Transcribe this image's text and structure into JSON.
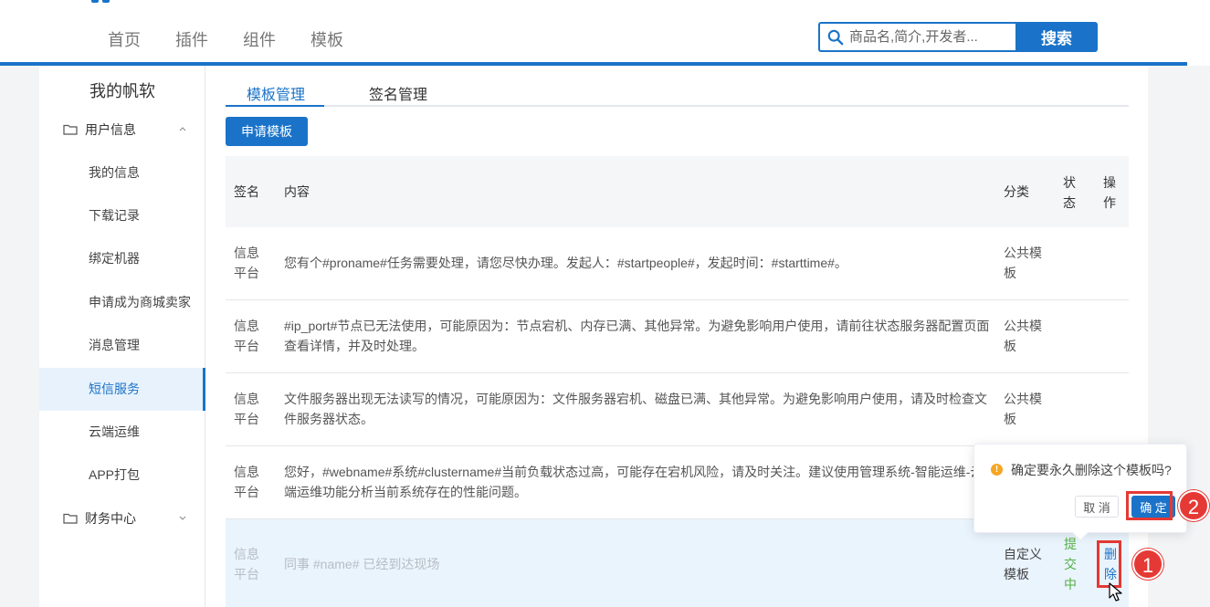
{
  "header": {
    "nav": [
      "首页",
      "插件",
      "组件",
      "模板"
    ],
    "search_placeholder": "商品名,简介,开发者...",
    "search_button": "搜索"
  },
  "sidebar": {
    "title": "我的帆软",
    "group_user": "用户信息",
    "items": [
      "我的信息",
      "下载记录",
      "绑定机器",
      "申请成为商城卖家",
      "消息管理",
      "短信服务",
      "云端运维",
      "APP打包"
    ],
    "active_item": "短信服务",
    "group_finance": "财务中心"
  },
  "tabs": [
    "模板管理",
    "签名管理"
  ],
  "apply_button": "申请模板",
  "table": {
    "headers": {
      "signature": "签名",
      "content": "内容",
      "category": "分类",
      "status_l1": "状",
      "status_l2": "态",
      "action_l1": "操",
      "action_l2": "作"
    },
    "rows": [
      {
        "sig_l1": "信息",
        "sig_l2": "平台",
        "content": "您有个#proname#任务需要处理，请您尽快办理。发起人：#startpeople#，发起时间：#starttime#。",
        "cat_l1": "公共模",
        "cat_l2": "板"
      },
      {
        "sig_l1": "信息",
        "sig_l2": "平台",
        "content": "#ip_port#节点已无法使用，可能原因为：节点宕机、内存已满、其他异常。为避免影响用户使用，请前往状态服务器配置页面查看详情，并及时处理。",
        "cat_l1": "公共模",
        "cat_l2": "板"
      },
      {
        "sig_l1": "信息",
        "sig_l2": "平台",
        "content": "文件服务器出现无法读写的情况，可能原因为：文件服务器宕机、磁盘已满、其他异常。为避免影响用户使用，请及时检查文件服务器状态。",
        "cat_l1": "公共模",
        "cat_l2": "板"
      },
      {
        "sig_l1": "信息",
        "sig_l2": "平台",
        "content": "您好，#webname#系统#clustername#当前负载状态过高，可能存在宕机风险，请及时关注。建议使用管理系统-智能运维-云端运维功能分析当前系统存在的性能问题。",
        "cat_l1": "",
        "cat_l2": ""
      },
      {
        "sig_l1": "信息",
        "sig_l2": "平台",
        "content": "同事 #name# 已经到达现场",
        "cat_l1": "自定义",
        "cat_l2": "模板",
        "status": [
          "提",
          "交",
          "中"
        ],
        "action": [
          "删",
          "除"
        ]
      }
    ]
  },
  "popconfirm": {
    "message": "确定要永久删除这个模板吗?",
    "cancel": "取 消",
    "confirm": "确 定"
  },
  "steps": [
    "1",
    "2"
  ],
  "colors": {
    "primary": "#1a73c8",
    "status_green": "#52b043",
    "annotation_red": "#e53935",
    "warning": "#f5a623"
  },
  "icons": [
    "search-icon",
    "folder-icon",
    "chevron-up-icon",
    "chevron-down-icon",
    "warning-icon",
    "cursor-icon"
  ]
}
